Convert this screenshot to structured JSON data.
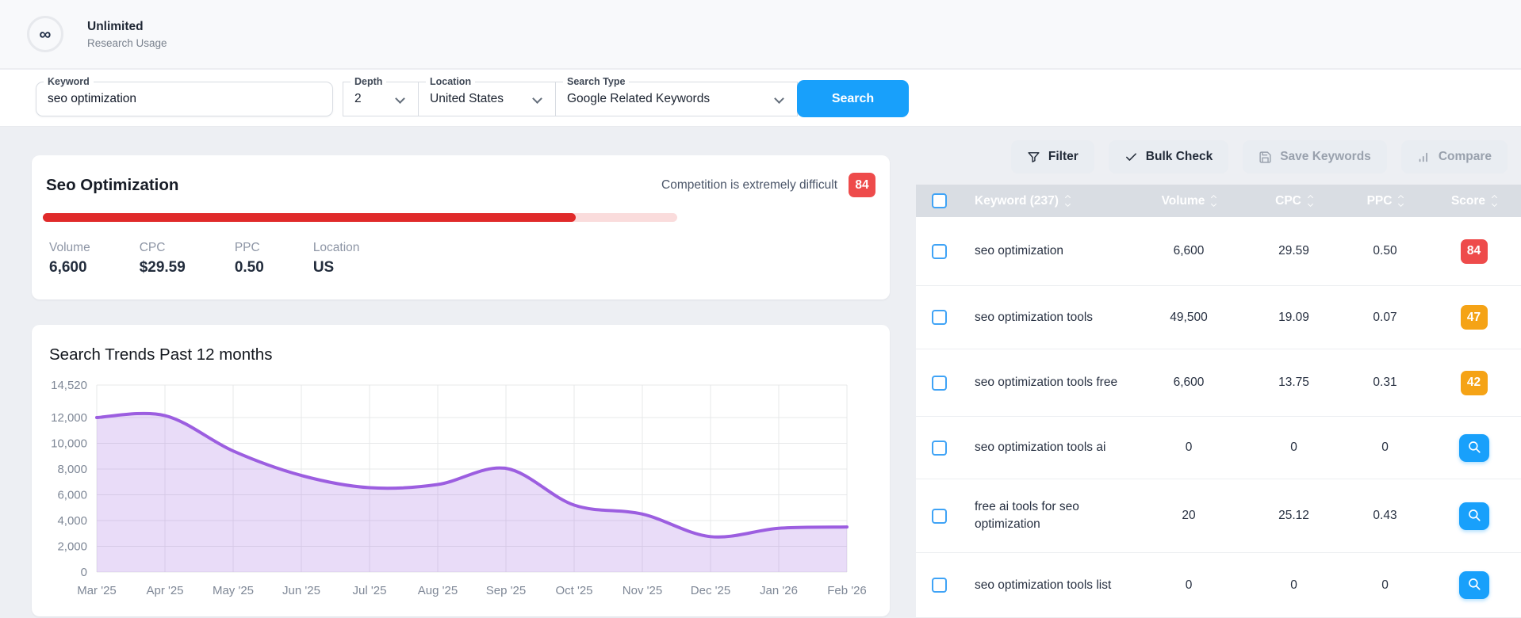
{
  "header": {
    "plan": "Unlimited",
    "usage_label": "Research Usage",
    "infinity_glyph": "∞"
  },
  "search_form": {
    "keyword": {
      "label": "Keyword",
      "value": "seo optimization"
    },
    "depth": {
      "label": "Depth",
      "value": "2"
    },
    "location": {
      "label": "Location",
      "value": "United States"
    },
    "search_type": {
      "label": "Search Type",
      "value": "Google Related Keywords"
    },
    "search_button": "Search"
  },
  "overview": {
    "title": "Seo Optimization",
    "competition_text": "Competition is extremely difficult",
    "score": "84",
    "progress_percent": 84,
    "stats": [
      {
        "label": "Volume",
        "value": "6,600"
      },
      {
        "label": "CPC",
        "value": "$29.59"
      },
      {
        "label": "PPC",
        "value": "0.50"
      },
      {
        "label": "Location",
        "value": "US"
      }
    ]
  },
  "chart_data": {
    "type": "area",
    "title": "Search Trends Past 12 months",
    "x": [
      "Mar '25",
      "Apr '25",
      "May '25",
      "Jun '25",
      "Jul '25",
      "Aug '25",
      "Sep '25",
      "Oct '25",
      "Nov '25",
      "Dec '25",
      "Jan '26",
      "Feb '26"
    ],
    "values": [
      12000,
      12150,
      9400,
      7500,
      6550,
      6800,
      8050,
      5200,
      4500,
      2750,
      3400,
      3500
    ],
    "y_ticks": [
      0,
      2000,
      4000,
      6000,
      8000,
      10000,
      12000,
      14520
    ],
    "ylim": [
      0,
      14520
    ],
    "xlabel": "",
    "ylabel": "",
    "grid": true,
    "legend": false,
    "line_color": "#9c5ee0",
    "fill_color": "rgba(156,94,224,0.22)"
  },
  "toolbar": {
    "buttons": [
      {
        "label": "Filter",
        "icon": "funnel-icon",
        "disabled": false
      },
      {
        "label": "Bulk Check",
        "icon": "check-icon",
        "disabled": false
      },
      {
        "label": "Save Keywords",
        "icon": "save-icon",
        "disabled": true
      },
      {
        "label": "Compare",
        "icon": "bar-chart-icon",
        "disabled": true
      }
    ]
  },
  "table": {
    "columns": [
      {
        "label": "Keyword (237)",
        "sortable": true
      },
      {
        "label": "Volume",
        "sortable": true
      },
      {
        "label": "CPC",
        "sortable": true
      },
      {
        "label": "PPC",
        "sortable": true
      },
      {
        "label": "Score",
        "sortable": true
      }
    ],
    "rows": [
      {
        "keyword": "seo optimization",
        "volume": "6,600",
        "cpc": "29.59",
        "ppc": "0.50",
        "score": "84",
        "score_type": "red"
      },
      {
        "keyword": "seo optimization tools",
        "volume": "49,500",
        "cpc": "19.09",
        "ppc": "0.07",
        "score": "47",
        "score_type": "orange"
      },
      {
        "keyword": "seo optimization tools free",
        "volume": "6,600",
        "cpc": "13.75",
        "ppc": "0.31",
        "score": "42",
        "score_type": "orange"
      },
      {
        "keyword": "seo optimization tools ai",
        "volume": "0",
        "cpc": "0",
        "ppc": "0",
        "score_type": "search"
      },
      {
        "keyword": "free ai tools for seo optimization",
        "volume": "20",
        "cpc": "25.12",
        "ppc": "0.43",
        "score_type": "search"
      },
      {
        "keyword": "seo optimization tools list",
        "volume": "0",
        "cpc": "0",
        "ppc": "0",
        "score_type": "search"
      }
    ]
  },
  "colors": {
    "accent_blue": "#18a0fb",
    "score_red": "#ee4b4b",
    "score_orange": "#f5a316",
    "progress_red": "#e02a2a",
    "progress_track": "#fadcdc",
    "chart_line": "#9c5ee0",
    "table_header_bg": "#d9dde3"
  }
}
